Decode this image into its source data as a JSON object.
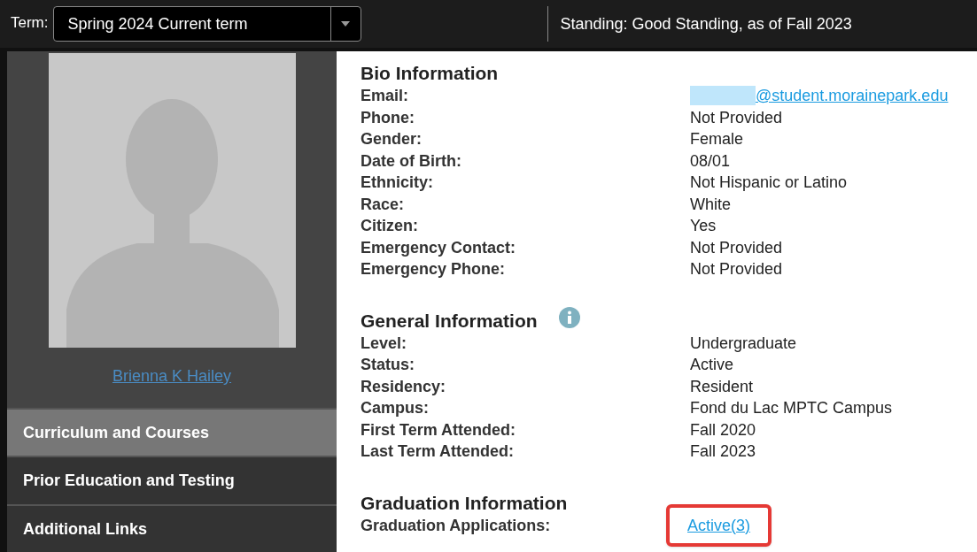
{
  "top_bar": {
    "term_label": "Term:",
    "term_value": "Spring 2024 Current term",
    "standing_label": "Standing:",
    "standing_value": "Good Standing, as of Fall 2023"
  },
  "sidebar": {
    "student_name": "Brienna K Hailey",
    "items": [
      {
        "label": "Curriculum and Courses",
        "selected": true
      },
      {
        "label": "Prior Education and Testing",
        "selected": false
      },
      {
        "label": "Additional Links",
        "selected": false
      }
    ]
  },
  "sections": [
    {
      "title": "Bio Information",
      "info": false,
      "rows": [
        {
          "label": "Email:",
          "value": "@student.morainepark.edu",
          "kind": "redacted_link"
        },
        {
          "label": "Phone:",
          "value": "Not Provided",
          "kind": "text"
        },
        {
          "label": "Gender:",
          "value": "Female",
          "kind": "text"
        },
        {
          "label": "Date of Birth:",
          "value": "08/01",
          "kind": "text"
        },
        {
          "label": "Ethnicity:",
          "value": "Not Hispanic or Latino",
          "kind": "text"
        },
        {
          "label": "Race:",
          "value": "White",
          "kind": "text"
        },
        {
          "label": "Citizen:",
          "value": "Yes",
          "kind": "text"
        },
        {
          "label": "Emergency Contact:",
          "value": "Not Provided",
          "kind": "text"
        },
        {
          "label": "Emergency Phone:",
          "value": "Not Provided",
          "kind": "text"
        }
      ]
    },
    {
      "title": "General Information",
      "info": true,
      "rows": [
        {
          "label": "Level:",
          "value": "Undergraduate",
          "kind": "text"
        },
        {
          "label": "Status:",
          "value": "Active",
          "kind": "text"
        },
        {
          "label": "Residency:",
          "value": "Resident",
          "kind": "text"
        },
        {
          "label": "Campus:",
          "value": "Fond du Lac MPTC Campus",
          "kind": "text"
        },
        {
          "label": "First Term Attended:",
          "value": "Fall 2020",
          "kind": "text"
        },
        {
          "label": "Last Term Attended:",
          "value": "Fall 2023",
          "kind": "text"
        }
      ]
    },
    {
      "title": "Graduation Information",
      "info": false,
      "rows": [
        {
          "label": "Graduation Applications:",
          "value": "Active(3)",
          "kind": "link",
          "highlighted": true
        }
      ]
    }
  ]
}
